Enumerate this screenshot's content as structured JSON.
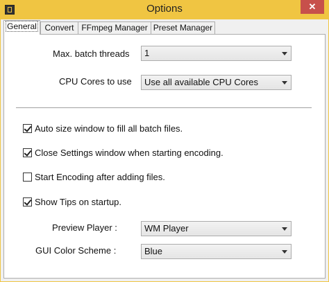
{
  "window": {
    "title": "Options",
    "close_glyph": "✕"
  },
  "tabs": [
    {
      "label": "General",
      "active": true
    },
    {
      "label": "Convert",
      "active": false
    },
    {
      "label": "FFmpeg Manager",
      "active": false
    },
    {
      "label": "Preset Manager",
      "active": false
    }
  ],
  "general": {
    "batch_threads": {
      "label": "Max. batch threads",
      "value": "1"
    },
    "cpu_cores": {
      "label": "CPU Cores to use",
      "value": "Use all available CPU Cores"
    },
    "checkboxes": [
      {
        "label": "Auto size window to fill all batch files.",
        "checked": true
      },
      {
        "label": "Close Settings window when starting encoding.",
        "checked": true
      },
      {
        "label": "Start Encoding after adding files.",
        "checked": false
      },
      {
        "label": "Show Tips on startup.",
        "checked": true
      }
    ],
    "preview_player": {
      "label": "Preview Player :",
      "value": "WM Player"
    },
    "color_scheme": {
      "label": "GUI Color Scheme :",
      "value": "Blue"
    }
  },
  "colors": {
    "titlebar": "#f0c542",
    "close_button": "#c7504b",
    "panel_bg": "#ffffff"
  },
  "icons": {
    "app": "app-icon",
    "close": "close-icon",
    "dropdown": "chevron-down-icon",
    "check": "checkmark-icon"
  }
}
